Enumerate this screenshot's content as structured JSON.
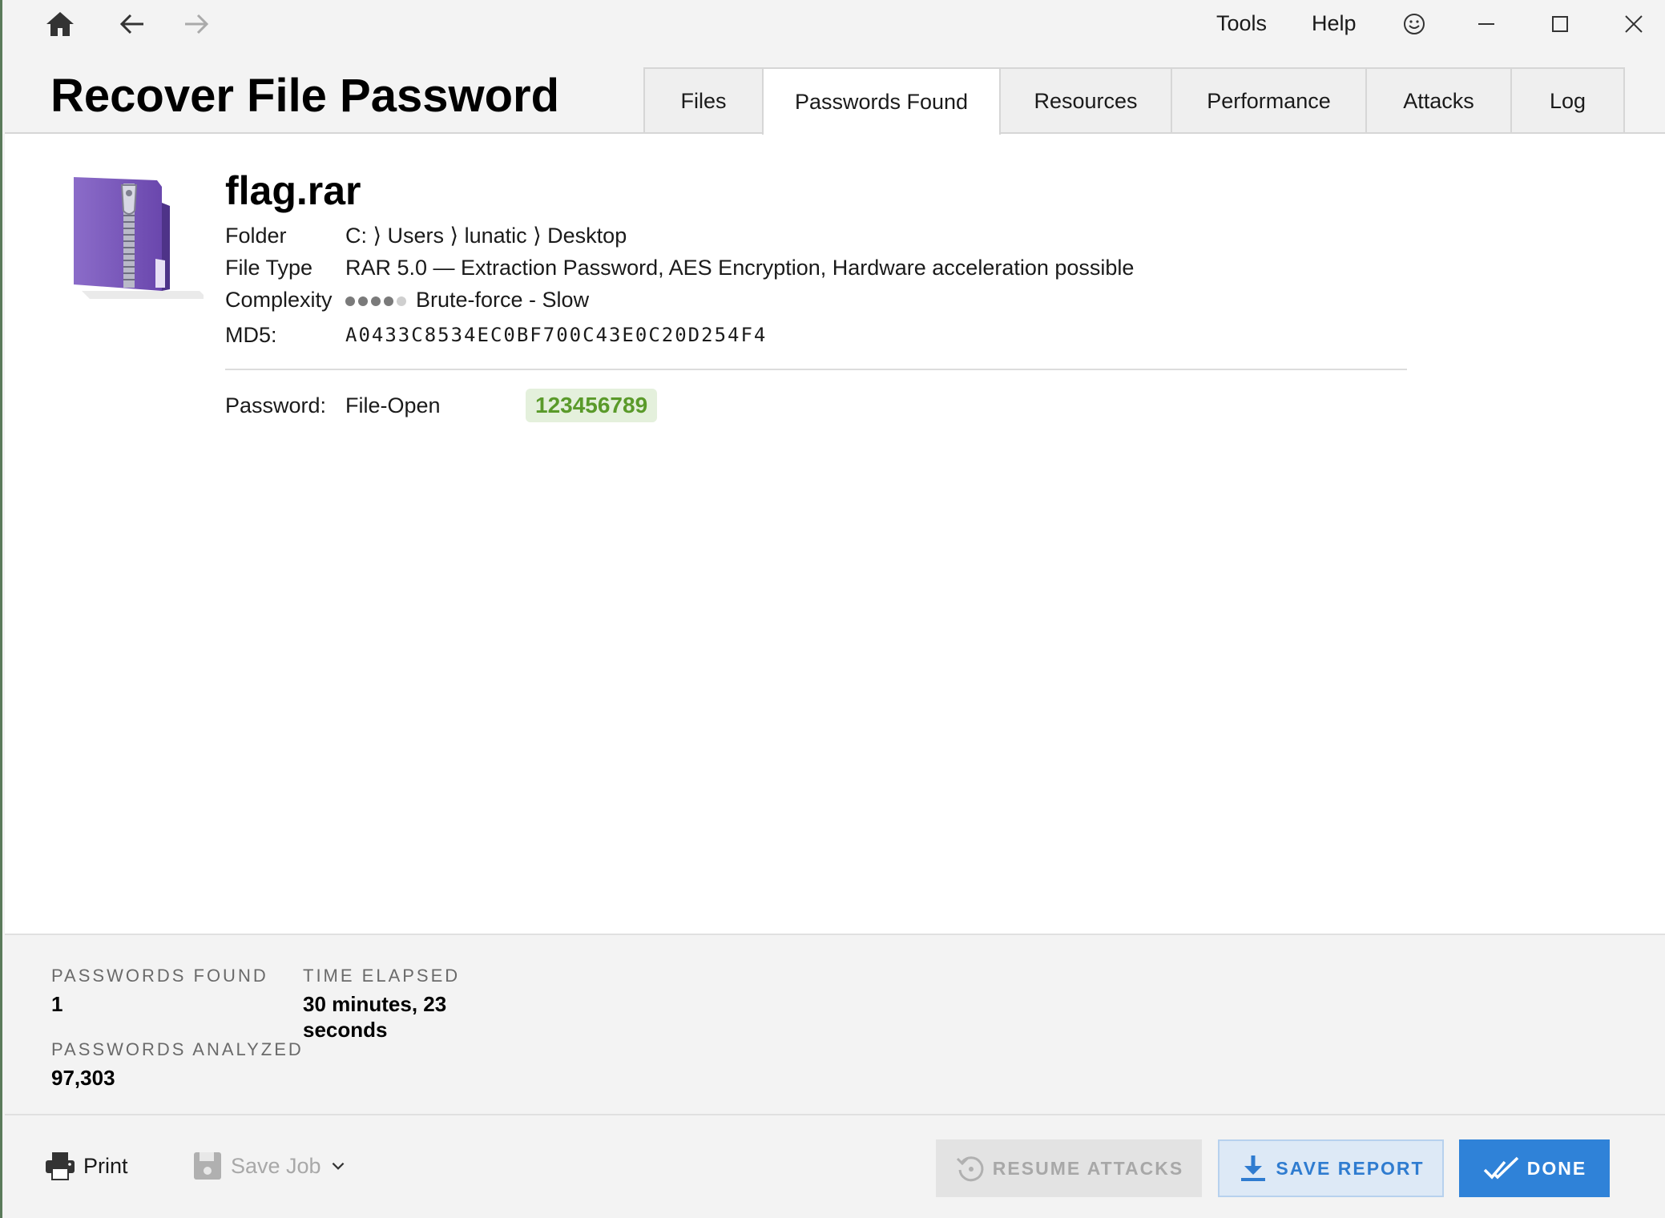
{
  "titlebar": {
    "menu": {
      "tools": "Tools",
      "help": "Help"
    }
  },
  "app": {
    "title": "Recover File Password"
  },
  "tabs": [
    {
      "label": "Files"
    },
    {
      "label": "Passwords Found",
      "active": true
    },
    {
      "label": "Resources"
    },
    {
      "label": "Performance"
    },
    {
      "label": "Attacks"
    },
    {
      "label": "Log"
    }
  ],
  "file": {
    "name": "flag.rar",
    "folder_label": "Folder",
    "folder_value": "C: ⟩ Users ⟩ lunatic ⟩ Desktop",
    "type_label": "File Type",
    "type_value": "RAR 5.0 — Extraction Password, AES Encryption, Hardware acceleration possible",
    "complexity_label": "Complexity",
    "complexity_level": 4,
    "complexity_max": 5,
    "complexity_value": "Brute-force - Slow",
    "md5_label": "MD5:",
    "md5_value": "A0433C8534EC0BF700C43E0C20D254F4",
    "password_label": "Password:",
    "password_type": "File-Open",
    "password_value": "123456789"
  },
  "stats": {
    "found_label": "PASSWORDS FOUND",
    "found_value": "1",
    "analyzed_label": "PASSWORDS ANALYZED",
    "analyzed_value": "97,303",
    "elapsed_label": "TIME ELAPSED",
    "elapsed_line1": "30 minutes, 23",
    "elapsed_line2": "seconds"
  },
  "footer": {
    "print_label": "Print",
    "save_job_label": "Save Job",
    "resume_label": "RESUME ATTACKS",
    "save_report_label": "SAVE REPORT",
    "done_label": "DONE"
  },
  "colors": {
    "accent": "#2f82d8",
    "password_green": "#5a9a2a",
    "password_bg": "#e4f0dc"
  }
}
